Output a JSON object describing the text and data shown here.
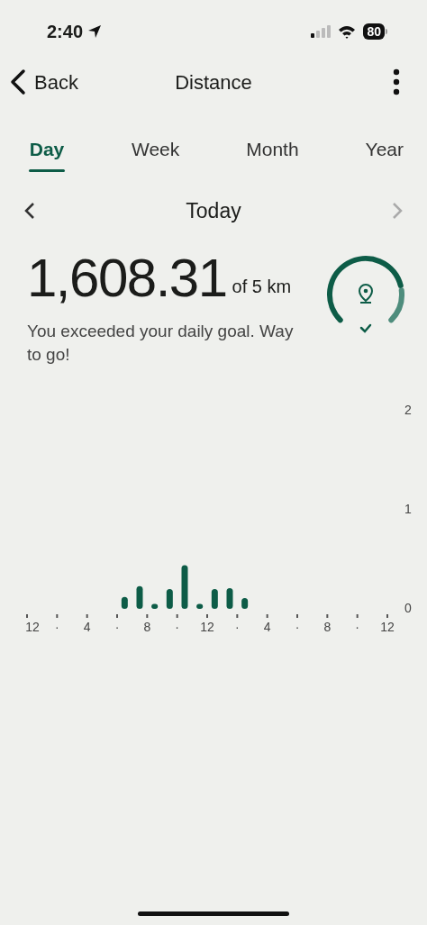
{
  "status_bar": {
    "time": "2:40",
    "battery": "80"
  },
  "nav": {
    "back": "Back",
    "title": "Distance"
  },
  "tabs": [
    {
      "label": "Day",
      "selected": true
    },
    {
      "label": "Week",
      "selected": false
    },
    {
      "label": "Month",
      "selected": false
    },
    {
      "label": "Year",
      "selected": false
    }
  ],
  "period": {
    "label": "Today",
    "prev_disabled": false,
    "next_disabled": true
  },
  "summary": {
    "value": "1,608.31",
    "goal": "of 5 km",
    "message": "You exceeded your daily goal. Way to go!"
  },
  "y_axis_labels": [
    "2",
    "1",
    "0"
  ],
  "time_axis_labels": [
    "12",
    "·",
    "4",
    "·",
    "8",
    "·",
    "12",
    "·",
    "4",
    "·",
    "8",
    "·",
    "12"
  ]
}
